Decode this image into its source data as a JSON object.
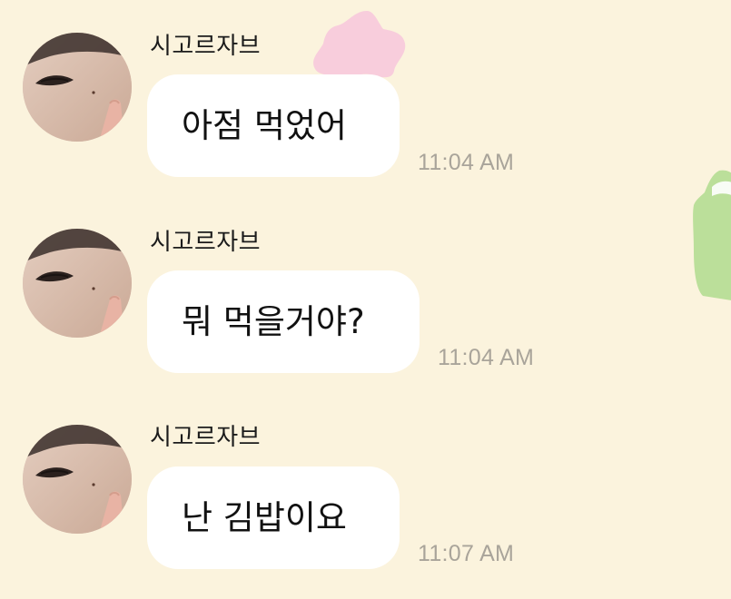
{
  "colors": {
    "background": "#fbf3dd",
    "bubble": "#ffffff",
    "timestamp": "#a9a49a",
    "sender_name": "#1b1b1b",
    "star_decor": "#f7c9dc",
    "note_decor": "#b7dd96"
  },
  "messages": [
    {
      "sender": "시고르자브",
      "avatar": "profile-photo",
      "text": "아점 먹었어",
      "time": "11:04 AM"
    },
    {
      "sender": "시고르자브",
      "avatar": "profile-photo",
      "text": "뭐 먹을거야?",
      "time": "11:04 AM"
    },
    {
      "sender": "시고르자브",
      "avatar": "profile-photo",
      "text": "난 김밥이요",
      "time": "11:07 AM"
    }
  ]
}
